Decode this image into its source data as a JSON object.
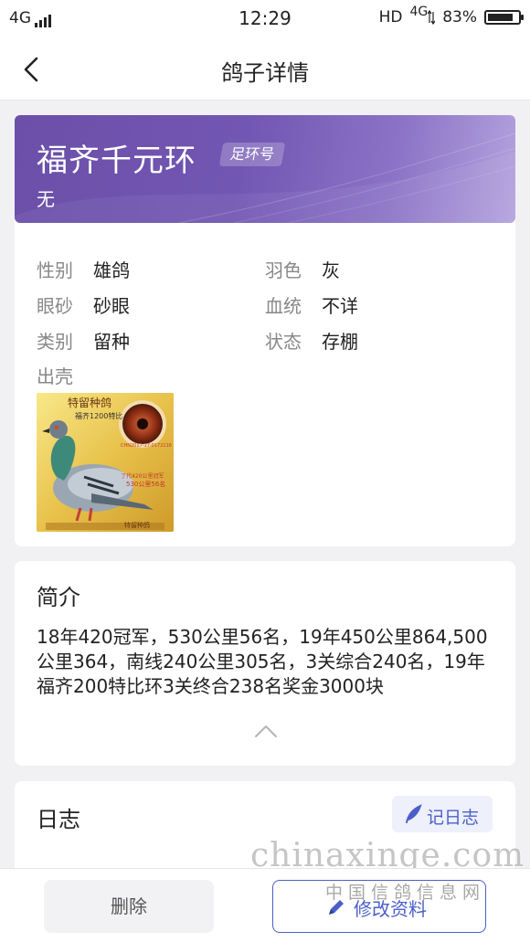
{
  "status_bar": {
    "network": "4G",
    "time": "12:29",
    "hd": "HD",
    "network_right": "4G",
    "battery": "83%",
    "battery_level": 0.83
  },
  "nav": {
    "title": "鸽子详情"
  },
  "header": {
    "ring_number": "福齐千元环",
    "badge": "足环号",
    "owner": "无",
    "gradient_start": "#6b4fa8",
    "gradient_end": "#b4a3de"
  },
  "attributes": [
    {
      "label": "性别",
      "value": "雄鸽"
    },
    {
      "label": "羽色",
      "value": "灰"
    },
    {
      "label": "眼砂",
      "value": "砂眼"
    },
    {
      "label": "血统",
      "value": "不详"
    },
    {
      "label": "类别",
      "value": "留种"
    },
    {
      "label": "状态",
      "value": "存棚"
    },
    {
      "label": "出壳",
      "value": ""
    }
  ],
  "intro": {
    "heading": "简介",
    "text": "18年420冠军，530公里56名，19年450公里864,500公里364，南线240公里305名，3关综合240名，19年福齐200特比环3关终合238名奖金3000块"
  },
  "log": {
    "heading": "日志",
    "button": "记日志",
    "accent": "#4b5fc9"
  },
  "bottom": {
    "delete": "删除",
    "edit": "修改资料"
  },
  "watermark": {
    "site": "chinaxinge.com",
    "name": "中国信鸽信息网"
  },
  "photo": {
    "top_text": "特留种鸽",
    "sub_text": "福齐1200特比",
    "ring_text": "CHN2017-17-0172116",
    "caption_1": "了代420公里冠军",
    "caption_2": "530公里56名",
    "footer_text": "特留种鸽",
    "icon": "pigeon-photo"
  }
}
